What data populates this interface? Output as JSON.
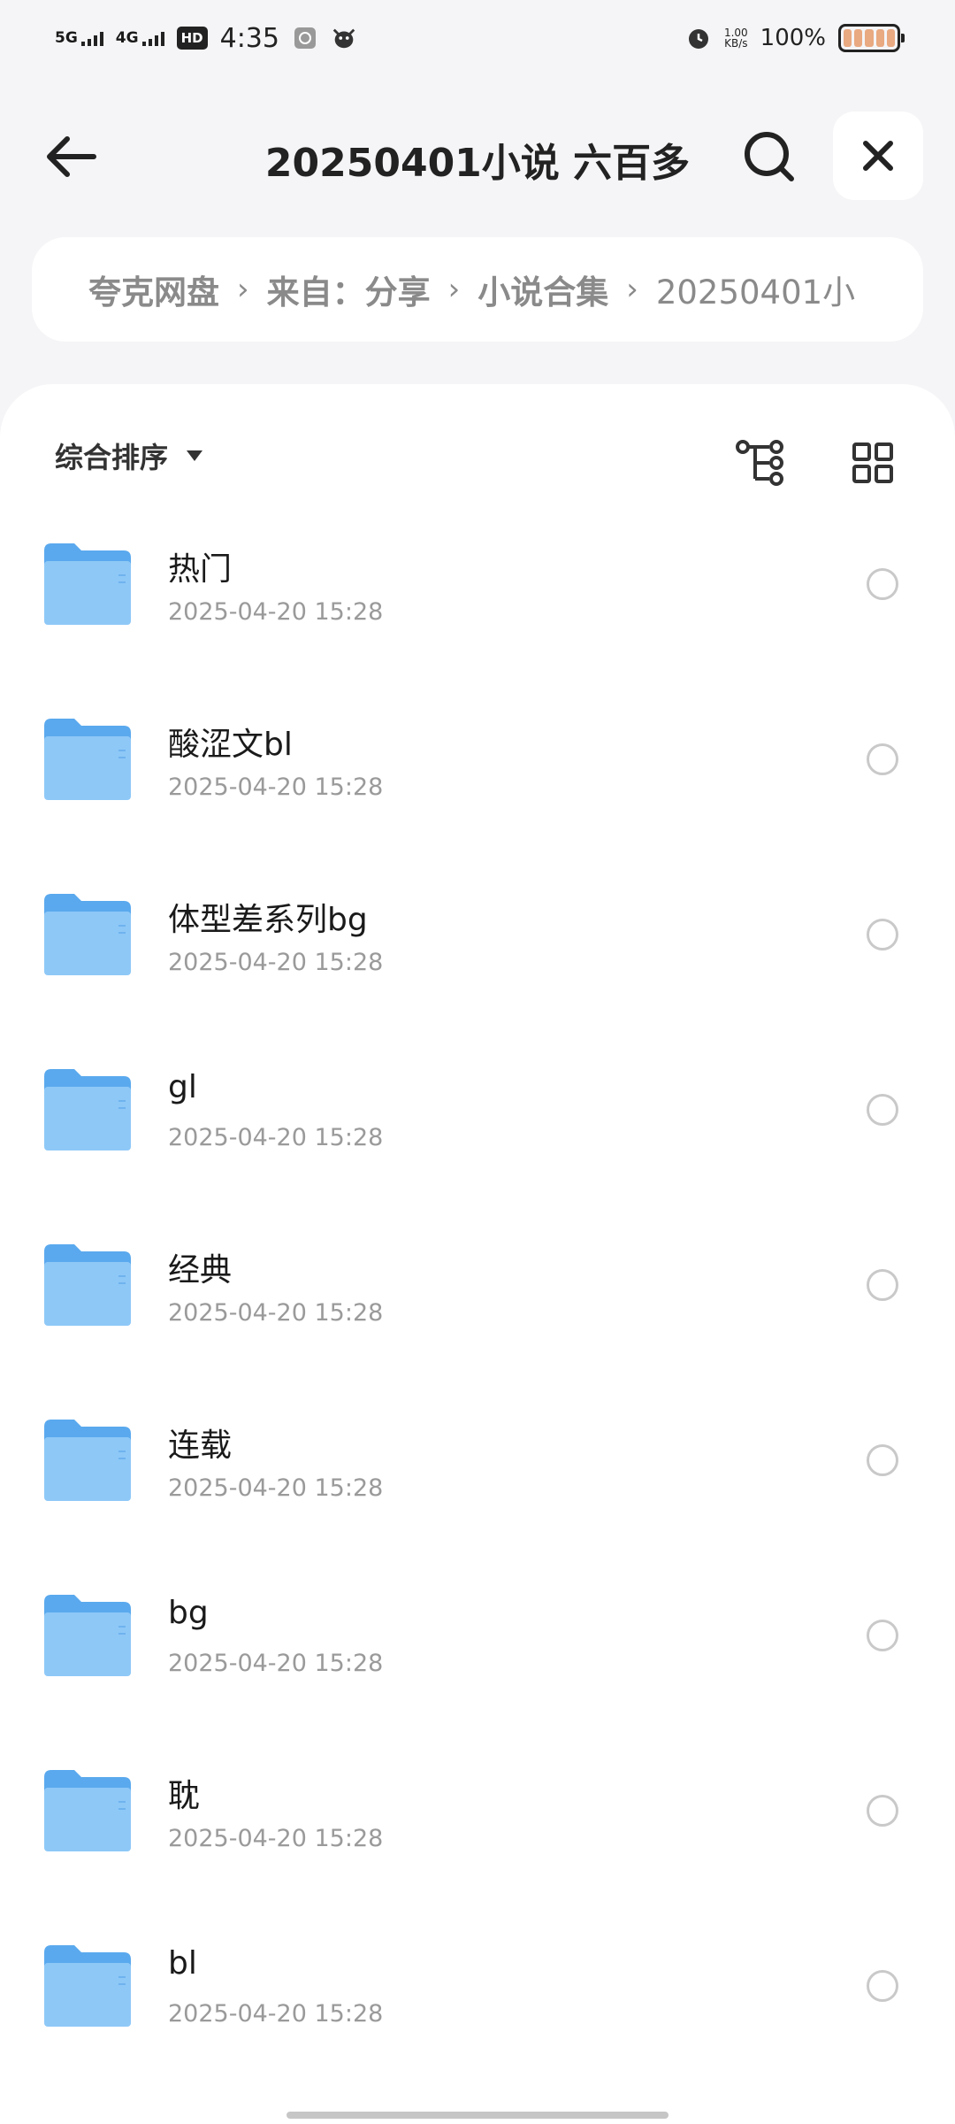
{
  "status_bar": {
    "signal1": "5G",
    "signal2": "4G",
    "hd": "HD",
    "time": "4:35",
    "net_speed_value": "1.00",
    "net_speed_unit": "KB/s",
    "battery_pct": "100%"
  },
  "header": {
    "title": "20250401小说 六百多"
  },
  "breadcrumb": {
    "items": [
      "夸克网盘",
      "来自：分享",
      "小说合集"
    ],
    "last": "20250401小"
  },
  "toolbar": {
    "sort_label": "综合排序"
  },
  "files": [
    {
      "name": "热门",
      "date": "2025-04-20 15:28"
    },
    {
      "name": "酸涩文bl",
      "date": "2025-04-20 15:28"
    },
    {
      "name": "体型差系列bg",
      "date": "2025-04-20 15:28"
    },
    {
      "name": "gl",
      "date": "2025-04-20 15:28"
    },
    {
      "name": "经典",
      "date": "2025-04-20 15:28"
    },
    {
      "name": "连载",
      "date": "2025-04-20 15:28"
    },
    {
      "name": "bg",
      "date": "2025-04-20 15:28"
    },
    {
      "name": "耽",
      "date": "2025-04-20 15:28"
    },
    {
      "name": "bl",
      "date": "2025-04-20 15:28"
    }
  ],
  "colors": {
    "folder_top": "#5aa9ee",
    "folder_front": "#8ec8f7",
    "background": "#f5f5f7",
    "battery_fill": "#e9a981"
  }
}
